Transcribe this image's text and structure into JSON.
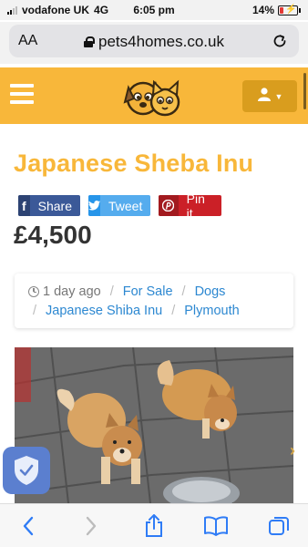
{
  "status_bar": {
    "carrier": "vodafone UK",
    "network": "4G",
    "time": "6:05 pm",
    "battery": "14%"
  },
  "browser": {
    "text_size_label": "AA",
    "url": "pets4homes.co.uk"
  },
  "site_header": {
    "menu_icon": "hamburger-menu-icon",
    "logo_icon": "dog-and-cat-logo",
    "user_icon": "user-icon"
  },
  "listing": {
    "title": "Japanese Sheba Inu",
    "price": "£4,500",
    "share": {
      "facebook": "Share",
      "twitter": "Tweet",
      "pinterest": "Pin it"
    },
    "posted": "1 day ago",
    "breadcrumbs": [
      "For Sale",
      "Dogs",
      "Japanese Shiba Inu",
      "Plymouth"
    ]
  },
  "toolbar": {
    "back_icon": "chevron-left-icon",
    "forward_icon": "chevron-right-icon",
    "share_icon": "share-icon",
    "bookmarks_icon": "book-icon",
    "tabs_icon": "tabs-icon"
  },
  "colors": {
    "brand": "#f8b73a",
    "link": "#2d88d1",
    "ios_blue": "#2f7cf6"
  }
}
